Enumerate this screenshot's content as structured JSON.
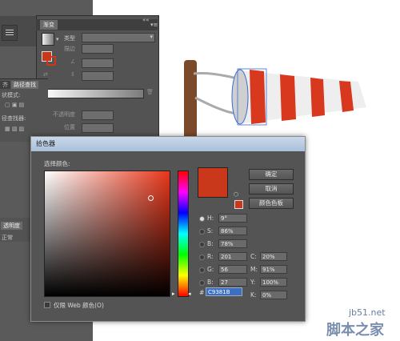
{
  "gradient_panel": {
    "tab": "渐变",
    "type_label": "类型",
    "stroke_label": "描边",
    "opacity_label": "不透明度",
    "location_label": "位置"
  },
  "side_panel": {
    "tab1": "齐",
    "tab2": "路径查找",
    "line1": "状模式:",
    "line2": "径查找器:",
    "bottom_tab": "透明度",
    "bottom_value": "正常"
  },
  "color_picker": {
    "title": "拾色器",
    "select_label": "选择颜色:",
    "ok": "确定",
    "cancel": "取消",
    "swatches": "颜色色板",
    "fields": [
      {
        "label": "H:",
        "value": "9°",
        "selected": true
      },
      {
        "label": "S:",
        "value": "86%",
        "selected": false
      },
      {
        "label": "B:",
        "value": "78%",
        "selected": false
      },
      {
        "label": "R:",
        "value": "201",
        "selected": false
      },
      {
        "label": "G:",
        "value": "56",
        "selected": false
      },
      {
        "label": "B:",
        "value": "27",
        "selected": false
      }
    ],
    "cmyk": [
      {
        "label": "C:",
        "value": "20%"
      },
      {
        "label": "M:",
        "value": "91%"
      },
      {
        "label": "Y:",
        "value": "100%"
      },
      {
        "label": "K:",
        "value": "0%"
      }
    ],
    "hex_label": "#",
    "hex": "C9381B",
    "web_only": "仅限 Web 颜色(O)",
    "color_hex": "#c9381b"
  },
  "watermark": {
    "line1": "jb51.net",
    "line2": "脚本之家"
  }
}
